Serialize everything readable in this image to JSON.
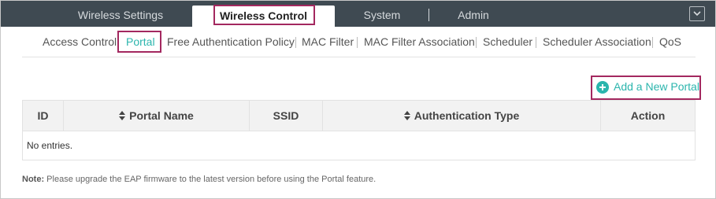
{
  "top_tabs": [
    {
      "label": "Wireless Settings",
      "active": false
    },
    {
      "label": "Wireless Control",
      "active": true
    },
    {
      "label": "System",
      "active": false
    },
    {
      "label": "Admin",
      "active": false
    }
  ],
  "sub_tabs": [
    {
      "label": "Access Control",
      "active": false
    },
    {
      "label": "Portal",
      "active": true
    },
    {
      "label": "Free Authentication Policy",
      "active": false
    },
    {
      "label": "MAC Filter",
      "active": false
    },
    {
      "label": "MAC Filter Association",
      "active": false
    },
    {
      "label": "Scheduler",
      "active": false
    },
    {
      "label": "Scheduler Association",
      "active": false
    },
    {
      "label": "QoS",
      "active": false
    }
  ],
  "add_button": {
    "label": "Add a New Portal",
    "icon": "plus-circle-icon"
  },
  "table": {
    "columns": [
      "ID",
      "Portal Name",
      "SSID",
      "Authentication Type",
      "Action"
    ],
    "sortable": [
      false,
      true,
      false,
      true,
      false
    ],
    "empty_text": "No entries."
  },
  "note": {
    "prefix": "Note:",
    "text": "Please upgrade the EAP firmware to the latest version before using the Portal feature."
  },
  "colors": {
    "accent": "#2bb5ad",
    "highlight": "#a3285f",
    "topbar": "#3f4a52"
  }
}
